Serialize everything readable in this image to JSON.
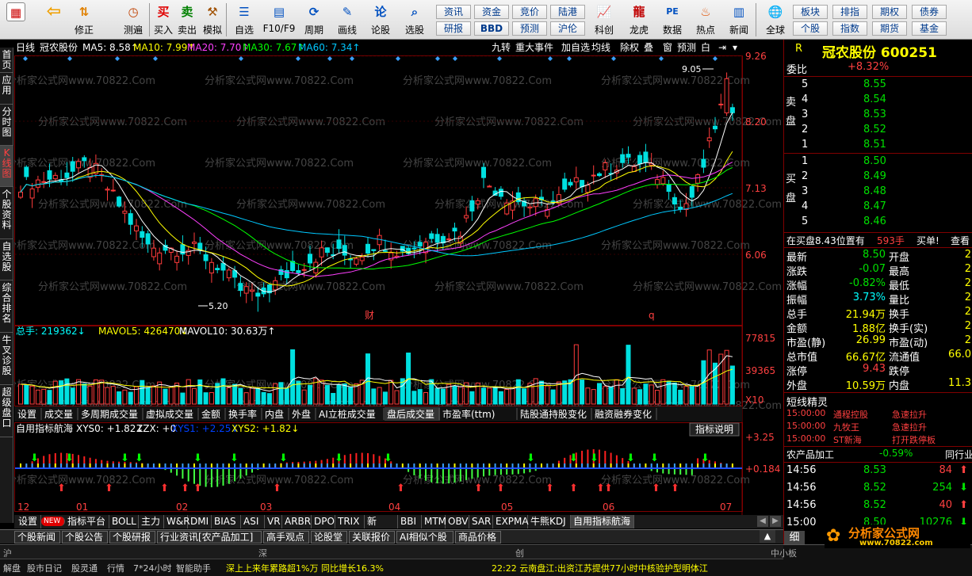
{
  "toolbar": {
    "left": [
      {
        "label": "",
        "icon": "grid"
      },
      {
        "label": "",
        "icon": "back"
      },
      {
        "label": "修正",
        "icon": "up-down"
      },
      {
        "label": "测遍",
        "icon": "clock"
      },
      {
        "label": "买入",
        "icon": "买"
      },
      {
        "label": "卖出",
        "icon": "卖"
      },
      {
        "label": "模拟",
        "icon": "hammer"
      },
      {
        "label": "自选",
        "icon": "list"
      },
      {
        "label": "F10/F9",
        "icon": "window"
      },
      {
        "label": "周期",
        "icon": "cycle"
      },
      {
        "label": "画线",
        "icon": "pencil"
      },
      {
        "label": "论股",
        "icon": "论"
      },
      {
        "label": "选股",
        "icon": "magnifier"
      },
      {
        "label": "科创",
        "icon": "chart"
      },
      {
        "label": "龙虎",
        "icon": "dragon"
      },
      {
        "label": "数据",
        "icon": "PE"
      },
      {
        "label": "热点",
        "icon": "fire"
      },
      {
        "label": "新闻",
        "icon": "news"
      },
      {
        "label": "全球",
        "icon": "globe"
      }
    ],
    "grid_a": [
      [
        "资讯",
        "资金",
        "竞价",
        "陆港"
      ],
      [
        "研报",
        "BBD",
        "预测",
        "沪伦"
      ]
    ],
    "grid_b": [
      [
        "板块",
        "排指",
        "期权",
        "债券"
      ],
      [
        "个股",
        "指数",
        "期货",
        "基金"
      ]
    ]
  },
  "nav": [
    {
      "label": "首页",
      "active": false
    },
    {
      "label": "应用",
      "active": false
    },
    {
      "label": "分时图",
      "active": false
    },
    {
      "label": "K线图",
      "active": true
    },
    {
      "label": "个股资料",
      "active": false
    },
    {
      "label": "自选股",
      "active": false
    },
    {
      "label": "综合排名",
      "active": false
    },
    {
      "label": "牛叉诊股",
      "active": false
    },
    {
      "label": "超级盘口",
      "active": false
    }
  ],
  "chart": {
    "header": {
      "period": "日线",
      "name": "冠农股份",
      "ma5": "MA5: 8.58↑",
      "ma10": "MA10: 7.99↑",
      "ma20": "MA20: 7.70↑",
      "ma30": "MA30: 7.67↑",
      "ma60": "MA60: 7.34↑"
    },
    "tools": [
      "九转",
      "重大事件",
      "加自选",
      "均线",
      "除权",
      "叠",
      "窗",
      "预测",
      "白"
    ],
    "price_axis": [
      "9.26",
      "8.20",
      "7.13",
      "6.06"
    ],
    "hi_label": "9.05",
    "lo_label": "5.20",
    "markers": [
      "财",
      "q"
    ],
    "watermark": "分析家公式网www.70822.Com",
    "volume": {
      "header_total": "总手: 219362↓",
      "mavol5": "MAVOL5: 426470↓",
      "mavol10": "MAVOL10: 30.63万↑",
      "axis": [
        "77815",
        "39365"
      ],
      "unit": "X10"
    },
    "sub_tabs": [
      "设置",
      "成交量",
      "多周期成交量",
      "虚拟成交量",
      "金额",
      "换手率",
      "内盘",
      "外盘",
      "AI立桩成交量",
      "盘后成交量",
      "市盈率(ttm)",
      "陆股通持股变化",
      "融资融券变化"
    ],
    "sub_tab_active": "盘后成交量",
    "indicator": {
      "name": "自用指标航海",
      "xys0": "XYS0: +1.82↓",
      "zzx": "ZZX: +0",
      "xys1": "XYS1: +2.25↓",
      "xys2": "XYS2: +1.82↓",
      "btn": "指标说明",
      "axis": [
        "+3.25",
        "+0.184"
      ]
    },
    "months": [
      "12",
      "01",
      "02",
      "03",
      "04",
      "05",
      "06",
      "07"
    ],
    "bottom_tabs": [
      "设置",
      "NEW",
      "指标平台",
      "BOLL",
      "主力",
      "W&R",
      "DMI",
      "BIAS",
      "ASI",
      "VR",
      "ARBR",
      "DPO",
      "TRIX",
      "新DMA",
      "BBI",
      "MTM",
      "OBV",
      "SAR",
      "EXPMA",
      "牛熊KDJ",
      "自用指标航海"
    ],
    "bottom_active": "自用指标航海"
  },
  "right": {
    "R": "R",
    "title": "冠农股份 600251",
    "wb_label": "委比",
    "wb_value": "+8.32%",
    "sell_side_label": "卖盘",
    "buy_side_label": "买盘",
    "asks": [
      {
        "n": "5",
        "p": "8.55"
      },
      {
        "n": "4",
        "p": "8.54"
      },
      {
        "n": "3",
        "p": "8.53"
      },
      {
        "n": "2",
        "p": "8.52"
      },
      {
        "n": "1",
        "p": "8.51"
      }
    ],
    "bids": [
      {
        "n": "1",
        "p": "8.50"
      },
      {
        "n": "2",
        "p": "8.49"
      },
      {
        "n": "3",
        "p": "8.48"
      },
      {
        "n": "4",
        "p": "8.47"
      },
      {
        "n": "5",
        "p": "8.46"
      }
    ],
    "order_info": {
      "text": "在买盘8.43位置有",
      "qty": "593手",
      "act": "买单!",
      "view": "查看"
    },
    "stats": [
      [
        "最新",
        "8.50",
        "开盘",
        ""
      ],
      [
        "涨跌",
        "-0.07",
        "最高",
        ""
      ],
      [
        "涨幅",
        "-0.82%",
        "最低",
        ""
      ],
      [
        "振幅",
        "3.73%",
        "量比",
        ""
      ],
      [
        "总手",
        "21.94万",
        "换手",
        ""
      ],
      [
        "金额",
        "1.88亿",
        "换手(实)",
        ""
      ],
      [
        "市盈(静)",
        "26.99",
        "市盈(动)",
        ""
      ],
      [
        "总市值",
        "66.67亿",
        "流通值",
        ""
      ],
      [
        "涨停",
        "9.43",
        "跌停",
        ""
      ],
      [
        "外盘",
        "10.59万",
        "内盘",
        ""
      ]
    ],
    "extra_right": [
      "2",
      "2",
      "2",
      "2",
      "2",
      "2",
      "2",
      "66.0",
      "",
      "11.3"
    ],
    "sprite_title": "短线精灵",
    "sprites": [
      {
        "t": "15:00:00",
        "n": "通程控股",
        "e": "急速拉升"
      },
      {
        "t": "15:00:00",
        "n": "九牧王",
        "e": "急速拉升"
      },
      {
        "t": "15:00:00",
        "n": "ST新海",
        "e": "打开跌停板"
      }
    ],
    "sector": {
      "name": "农产品加工",
      "pct": "-0.59%",
      "link": "同行业"
    },
    "ticks": [
      {
        "t": "14:56",
        "p": "8.53",
        "v": "84",
        "d": "up"
      },
      {
        "t": "14:56",
        "p": "8.52",
        "v": "254",
        "d": "down"
      },
      {
        "t": "14:56",
        "p": "8.52",
        "v": "40",
        "d": "up"
      },
      {
        "t": "15:00",
        "p": "8.50",
        "v": "10276",
        "d": "down"
      }
    ],
    "tick_tab": "细"
  },
  "news_tabs": [
    "个股新闻",
    "个股公告",
    "个股研报",
    "行业资讯[农产品加工]",
    "高手观点",
    "论股堂",
    "关联报价",
    "AI相似个股",
    "商品价格"
  ],
  "status": {
    "markets": [
      "沪",
      "深",
      "创",
      "中小板"
    ],
    "items": [
      "解盘",
      "股市日记",
      "股灵通",
      "行情",
      "7*24小时",
      "智能助手"
    ],
    "ticker": "22:22 云南盘江:出资江苏提供77小时中核验护型明体江",
    "scroll": "深上上来年累路超1%万 同比增长16.3%"
  },
  "logo": {
    "brand": "分析家公式网",
    "url": "www.70822.com"
  },
  "colors": {
    "up": "#ff3b3b",
    "down": "#00e0e0",
    "ma5": "#ffffff",
    "ma10": "#ffff00",
    "ma20": "#ff40ff",
    "ma30": "#00ff00",
    "ma60": "#00c8ff"
  }
}
